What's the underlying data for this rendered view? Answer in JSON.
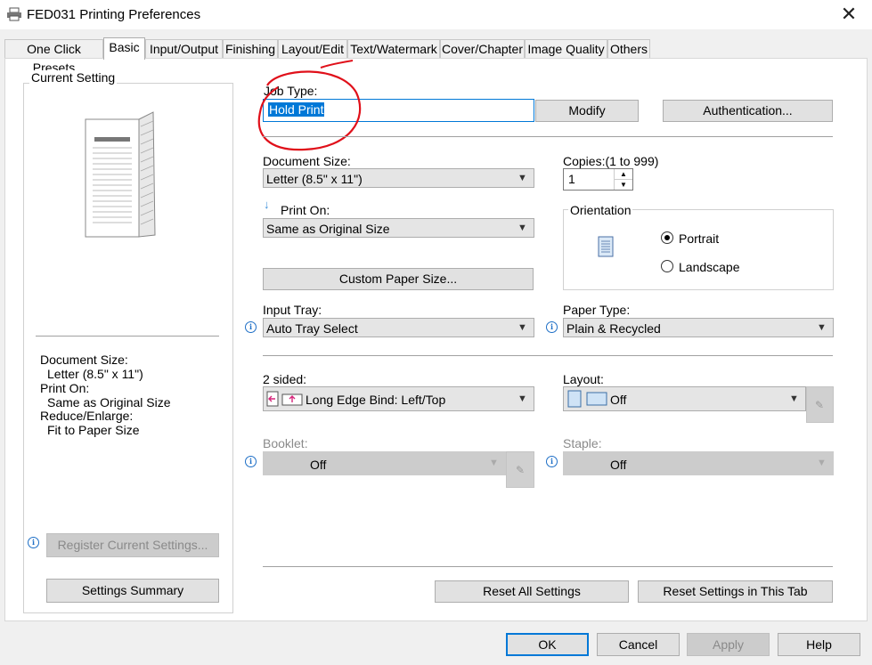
{
  "window": {
    "title": "FED031 Printing Preferences",
    "close_glyph": "✕"
  },
  "tabs": [
    "One Click Presets",
    "Basic",
    "Input/Output",
    "Finishing",
    "Layout/Edit",
    "Text/Watermark",
    "Cover/Chapter",
    "Image Quality",
    "Others"
  ],
  "active_tab": "Basic",
  "current_setting": {
    "title": "Current Setting",
    "lines": [
      "Document Size:",
      "Letter (8.5\" x 11\")",
      "Print On:",
      "Same as Original Size",
      "Reduce/Enlarge:",
      "Fit to Paper Size"
    ],
    "register_button": "Register Current Settings...",
    "summary_button": "Settings Summary"
  },
  "job_type": {
    "label": "Job Type:",
    "value": "Hold Print",
    "modify_button": "Modify",
    "auth_button": "Authentication..."
  },
  "document_size": {
    "label": "Document Size:",
    "value": "Letter (8.5\" x 11\")"
  },
  "copies": {
    "label": "Copies:(1 to 999)",
    "value": "1"
  },
  "print_on": {
    "label": "Print On:",
    "value": "Same as Original Size"
  },
  "orientation": {
    "label": "Orientation",
    "portrait": "Portrait",
    "landscape": "Landscape",
    "selected": "Portrait"
  },
  "custom_paper_button": "Custom Paper Size...",
  "input_tray": {
    "label": "Input Tray:",
    "value": "Auto Tray Select"
  },
  "paper_type": {
    "label": "Paper Type:",
    "value": "Plain & Recycled"
  },
  "two_sided": {
    "label": "2 sided:",
    "value": "Long Edge Bind: Left/Top"
  },
  "layout": {
    "label": "Layout:",
    "value": "Off"
  },
  "booklet": {
    "label": "Booklet:",
    "value": "Off"
  },
  "staple": {
    "label": "Staple:",
    "value": "Off"
  },
  "reset_all_button": "Reset All Settings",
  "reset_tab_button": "Reset Settings in This Tab",
  "footer": {
    "ok": "OK",
    "cancel": "Cancel",
    "apply": "Apply",
    "help": "Help"
  },
  "colors": {
    "annotation": "#e0101a",
    "selection": "#0078d7",
    "accent_border": "#0078d7"
  }
}
